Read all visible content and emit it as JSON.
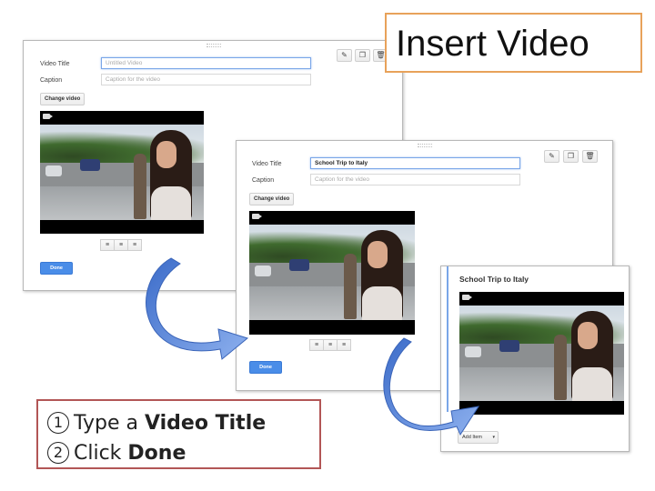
{
  "header": {
    "title": "Insert Video"
  },
  "editor_empty": {
    "video_title_label": "Video Title",
    "video_title_placeholder": "Untitled Video",
    "caption_label": "Caption",
    "caption_placeholder": "Caption for the video",
    "change_video_label": "Change video",
    "done_label": "Done"
  },
  "editor_filled": {
    "video_title_label": "Video Title",
    "video_title_value": "School Trip to Italy",
    "caption_label": "Caption",
    "caption_placeholder": "Caption for the video",
    "change_video_label": "Change video",
    "done_label": "Done"
  },
  "published": {
    "video_title": "School Trip to Italy",
    "add_item_label": "Add Item"
  },
  "toolbar_icons": [
    "pencil-icon",
    "copy-icon",
    "trash-icon"
  ],
  "align_icons": [
    "align-left-icon",
    "align-center-icon",
    "align-right-icon"
  ],
  "instructions": {
    "step1": {
      "number": "1",
      "prefix": "Type a ",
      "bold": "Video Title"
    },
    "step2": {
      "number": "2",
      "prefix": "Click ",
      "bold": "Done"
    }
  },
  "colors": {
    "title_border": "#e8a25a",
    "instructions_border": "#b25656",
    "done_button": "#4a8de8",
    "arrow": "#5b86d6"
  }
}
